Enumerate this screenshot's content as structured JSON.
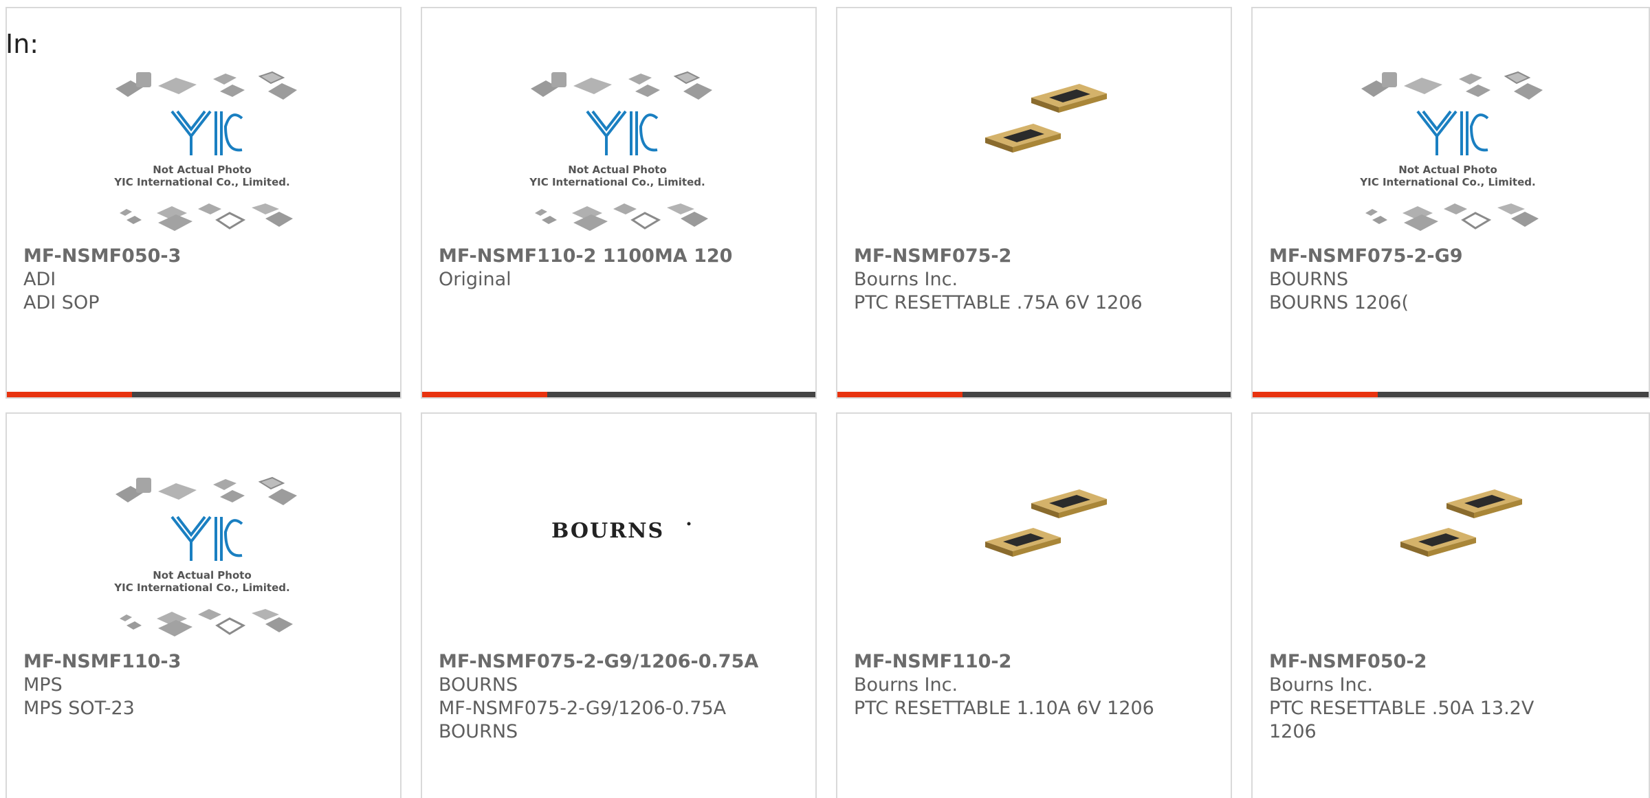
{
  "header": {
    "in_label": "In:"
  },
  "placeholder": {
    "line1": "Not Actual Photo",
    "line2": "YIC International Co., Limited.",
    "logo_text": "YIC"
  },
  "bourns_logo": "BOURNS",
  "colors": {
    "accent": "#e8330f",
    "bar": "#444444",
    "yic_blue": "#1a7fc1"
  },
  "cards": [
    {
      "image": "yic-placeholder",
      "name": "MF-NSMF050-3",
      "line1": "ADI",
      "line2": "ADI SOP",
      "line3": ""
    },
    {
      "image": "yic-placeholder",
      "name": "MF-NSMF110-2 1100MA 120",
      "line1": "Original",
      "line2": "",
      "line3": ""
    },
    {
      "image": "smd-fuse-photo",
      "name": "MF-NSMF075-2",
      "line1": "Bourns Inc.",
      "line2": "PTC RESETTABLE .75A 6V 1206",
      "line3": ""
    },
    {
      "image": "yic-placeholder",
      "name": "MF-NSMF075-2-G9",
      "line1": "BOURNS",
      "line2": "BOURNS 1206(",
      "line3": ""
    },
    {
      "image": "yic-placeholder",
      "name": "MF-NSMF110-3",
      "line1": "MPS",
      "line2": "MPS SOT-23",
      "line3": ""
    },
    {
      "image": "bourns-logo",
      "name": "MF-NSMF075-2-G9/1206-0.75A",
      "line1": "BOURNS",
      "line2": "MF-NSMF075-2-G9/1206-0.75A",
      "line3": "BOURNS"
    },
    {
      "image": "smd-fuse-photo",
      "name": "MF-NSMF110-2",
      "line1": "Bourns Inc.",
      "line2": "PTC RESETTABLE 1.10A 6V 1206",
      "line3": ""
    },
    {
      "image": "smd-fuse-photo",
      "name": "MF-NSMF050-2",
      "line1": "Bourns Inc.",
      "line2": "PTC RESETTABLE .50A 13.2V",
      "line3": "1206"
    }
  ]
}
